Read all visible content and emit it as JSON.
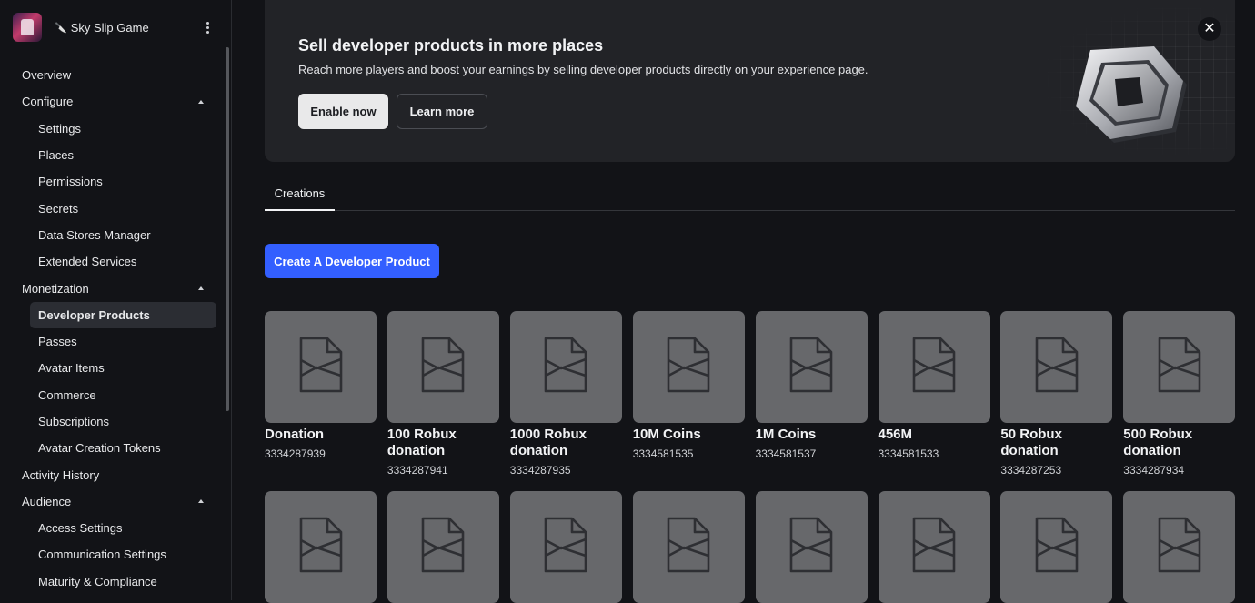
{
  "experience": {
    "name": "Sky Slip Game",
    "name_prefix_icon": "knife-icon"
  },
  "sidebar": {
    "items": [
      {
        "label": "Overview",
        "level": 0
      },
      {
        "label": "Configure",
        "level": 0,
        "expanded": true
      },
      {
        "label": "Settings",
        "level": 1
      },
      {
        "label": "Places",
        "level": 1
      },
      {
        "label": "Permissions",
        "level": 1
      },
      {
        "label": "Secrets",
        "level": 1
      },
      {
        "label": "Data Stores Manager",
        "level": 1
      },
      {
        "label": "Extended Services",
        "level": 1
      },
      {
        "label": "Monetization",
        "level": 0,
        "expanded": true
      },
      {
        "label": "Developer Products",
        "level": 1,
        "active": true
      },
      {
        "label": "Passes",
        "level": 1
      },
      {
        "label": "Avatar Items",
        "level": 1
      },
      {
        "label": "Commerce",
        "level": 1
      },
      {
        "label": "Subscriptions",
        "level": 1
      },
      {
        "label": "Avatar Creation Tokens",
        "level": 1
      },
      {
        "label": "Activity History",
        "level": 0
      },
      {
        "label": "Audience",
        "level": 0,
        "expanded": true
      },
      {
        "label": "Access Settings",
        "level": 1
      },
      {
        "label": "Communication Settings",
        "level": 1
      },
      {
        "label": "Maturity & Compliance",
        "level": 1
      }
    ]
  },
  "banner": {
    "title": "Sell developer products in more places",
    "subtitle": "Reach more players and boost your earnings by selling developer products directly on your experience page.",
    "primary_label": "Enable now",
    "secondary_label": "Learn more",
    "close_glyph": "✕"
  },
  "tabs": [
    {
      "label": "Creations",
      "active": true
    }
  ],
  "create_button_label": "Create A Developer Product",
  "products": [
    {
      "name": "Donation",
      "id": "3334287939"
    },
    {
      "name": "100 Robux donation",
      "id": "3334287941"
    },
    {
      "name": "1000 Robux donation",
      "id": "3334287935"
    },
    {
      "name": "10M Coins",
      "id": "3334581535"
    },
    {
      "name": "1M Coins",
      "id": "3334581537"
    },
    {
      "name": "456M",
      "id": "3334581533"
    },
    {
      "name": "50 Robux donation",
      "id": "3334287253"
    },
    {
      "name": "500 Robux donation",
      "id": "3334287934"
    }
  ],
  "products_second_row_placeholders": 8,
  "colors": {
    "accent": "#335FFF",
    "background": "#121317",
    "card_placeholder": "#67686B",
    "banner_bg": "#222327"
  }
}
